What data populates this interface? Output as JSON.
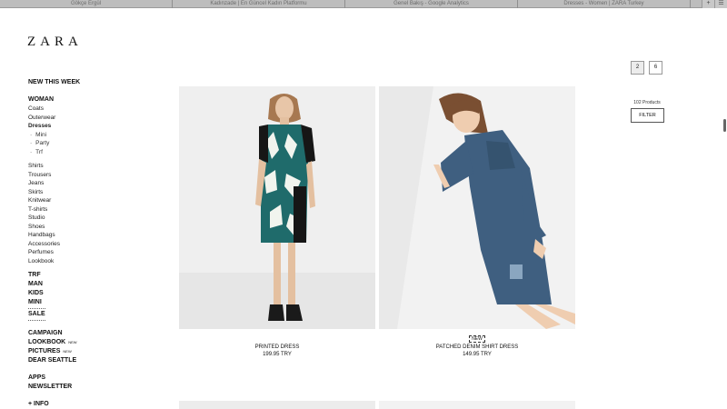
{
  "browser": {
    "tabs": [
      "Gökçe Ergül",
      "Kadınzade | En Güncel Kadın Platformu",
      "Genel Bakış - Google Analytics",
      "Dresses - Women | ZARA Turkey"
    ],
    "new_tab": "+",
    "menu": "☰"
  },
  "brand": {
    "logo": "ZARA"
  },
  "sidebar": {
    "new_this_week": "NEW THIS WEEK",
    "woman": "WOMAN",
    "categories_top": [
      "Coats",
      "Outerwear"
    ],
    "dresses": "Dresses",
    "dress_subs": [
      "Mini",
      "Party",
      "Trf"
    ],
    "categories": [
      "Shirts",
      "Trousers",
      "Jeans",
      "Skirts",
      "Knitwear",
      "T-shirts",
      "Studio",
      "Shoes",
      "Handbags",
      "Accessories",
      "Perfumes",
      "Lookbook"
    ],
    "sections": [
      "TRF",
      "MAN",
      "KIDS",
      "MINI"
    ],
    "sale": "SALE",
    "campaign": "CAMPAIGN",
    "lookbook": "LOOKBOOK",
    "pictures": "PICTURES",
    "new_label": "NEW",
    "dear_seattle": "DEAR SEATTLE",
    "apps": "APPS",
    "newsletter": "NEWSLETTER",
    "info": "+ INFO"
  },
  "grid": {
    "options": [
      "2",
      "6"
    ],
    "selected": "2",
    "product_count": "102 Products",
    "filter_label": "FILTER"
  },
  "products": [
    {
      "name": "PRINTED DRESS",
      "price": "199.95 TRY",
      "badge": ""
    },
    {
      "name": "PATCHED DENIM SHIRT DRESS",
      "price": "149.95 TRY",
      "badge": "NEW"
    }
  ],
  "colors": {
    "denim": "#3f5f80",
    "leaf_print": "#1f6b6b",
    "accent": "#111111"
  }
}
